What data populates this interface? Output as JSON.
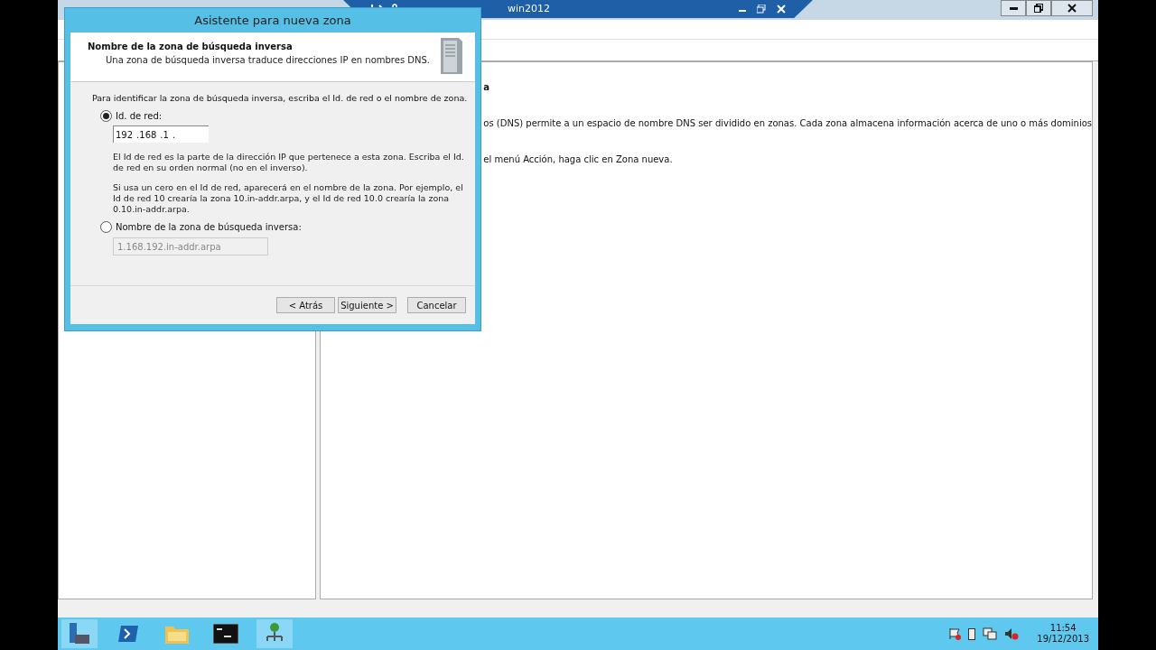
{
  "remote_bar": {
    "title": "win2012"
  },
  "background_window": {
    "heading": "a",
    "paragraphs": [
      "os (DNS) permite a un espacio de nombre DNS ser dividido en zonas. Cada zona almacena información acerca de uno o más dominios",
      "el menú Acción, haga clic en Zona nueva."
    ]
  },
  "dialog": {
    "title": "Asistente para nueva zona",
    "header_title": "Nombre de la zona de búsqueda inversa",
    "header_subtitle": "Una zona de búsqueda inversa traduce direcciones IP en nombres DNS.",
    "instruction": "Para identificar la zona de búsqueda inversa, escriba el Id. de red o el nombre de zona.",
    "options": [
      {
        "label": "Id. de red:",
        "selected": true,
        "kind": "network_id",
        "octets": [
          "192",
          ".168",
          ".1",
          "."
        ],
        "help": [
          "El Id de red es la parte de la dirección IP que pertenece a esta zona. Escriba el Id. de red en su orden normal (no en el inverso).",
          "Si usa un cero en el Id de red, aparecerá en el nombre de la zona.  Por ejemplo, el Id de red 10 crearía la zona 10.in-addr.arpa, y el Id de red 10.0 crearía la zona 0.10.in-addr.arpa."
        ]
      },
      {
        "label": "Nombre de la zona de búsqueda inversa:",
        "selected": false,
        "kind": "zone_name",
        "value": "1.168.192.in-addr.arpa",
        "disabled": true
      }
    ],
    "buttons": [
      "< Atrás",
      "Siguiente >",
      "Cancelar"
    ]
  },
  "taskbar": {
    "clock": {
      "time": "11:54",
      "date": "19/12/2013"
    }
  }
}
